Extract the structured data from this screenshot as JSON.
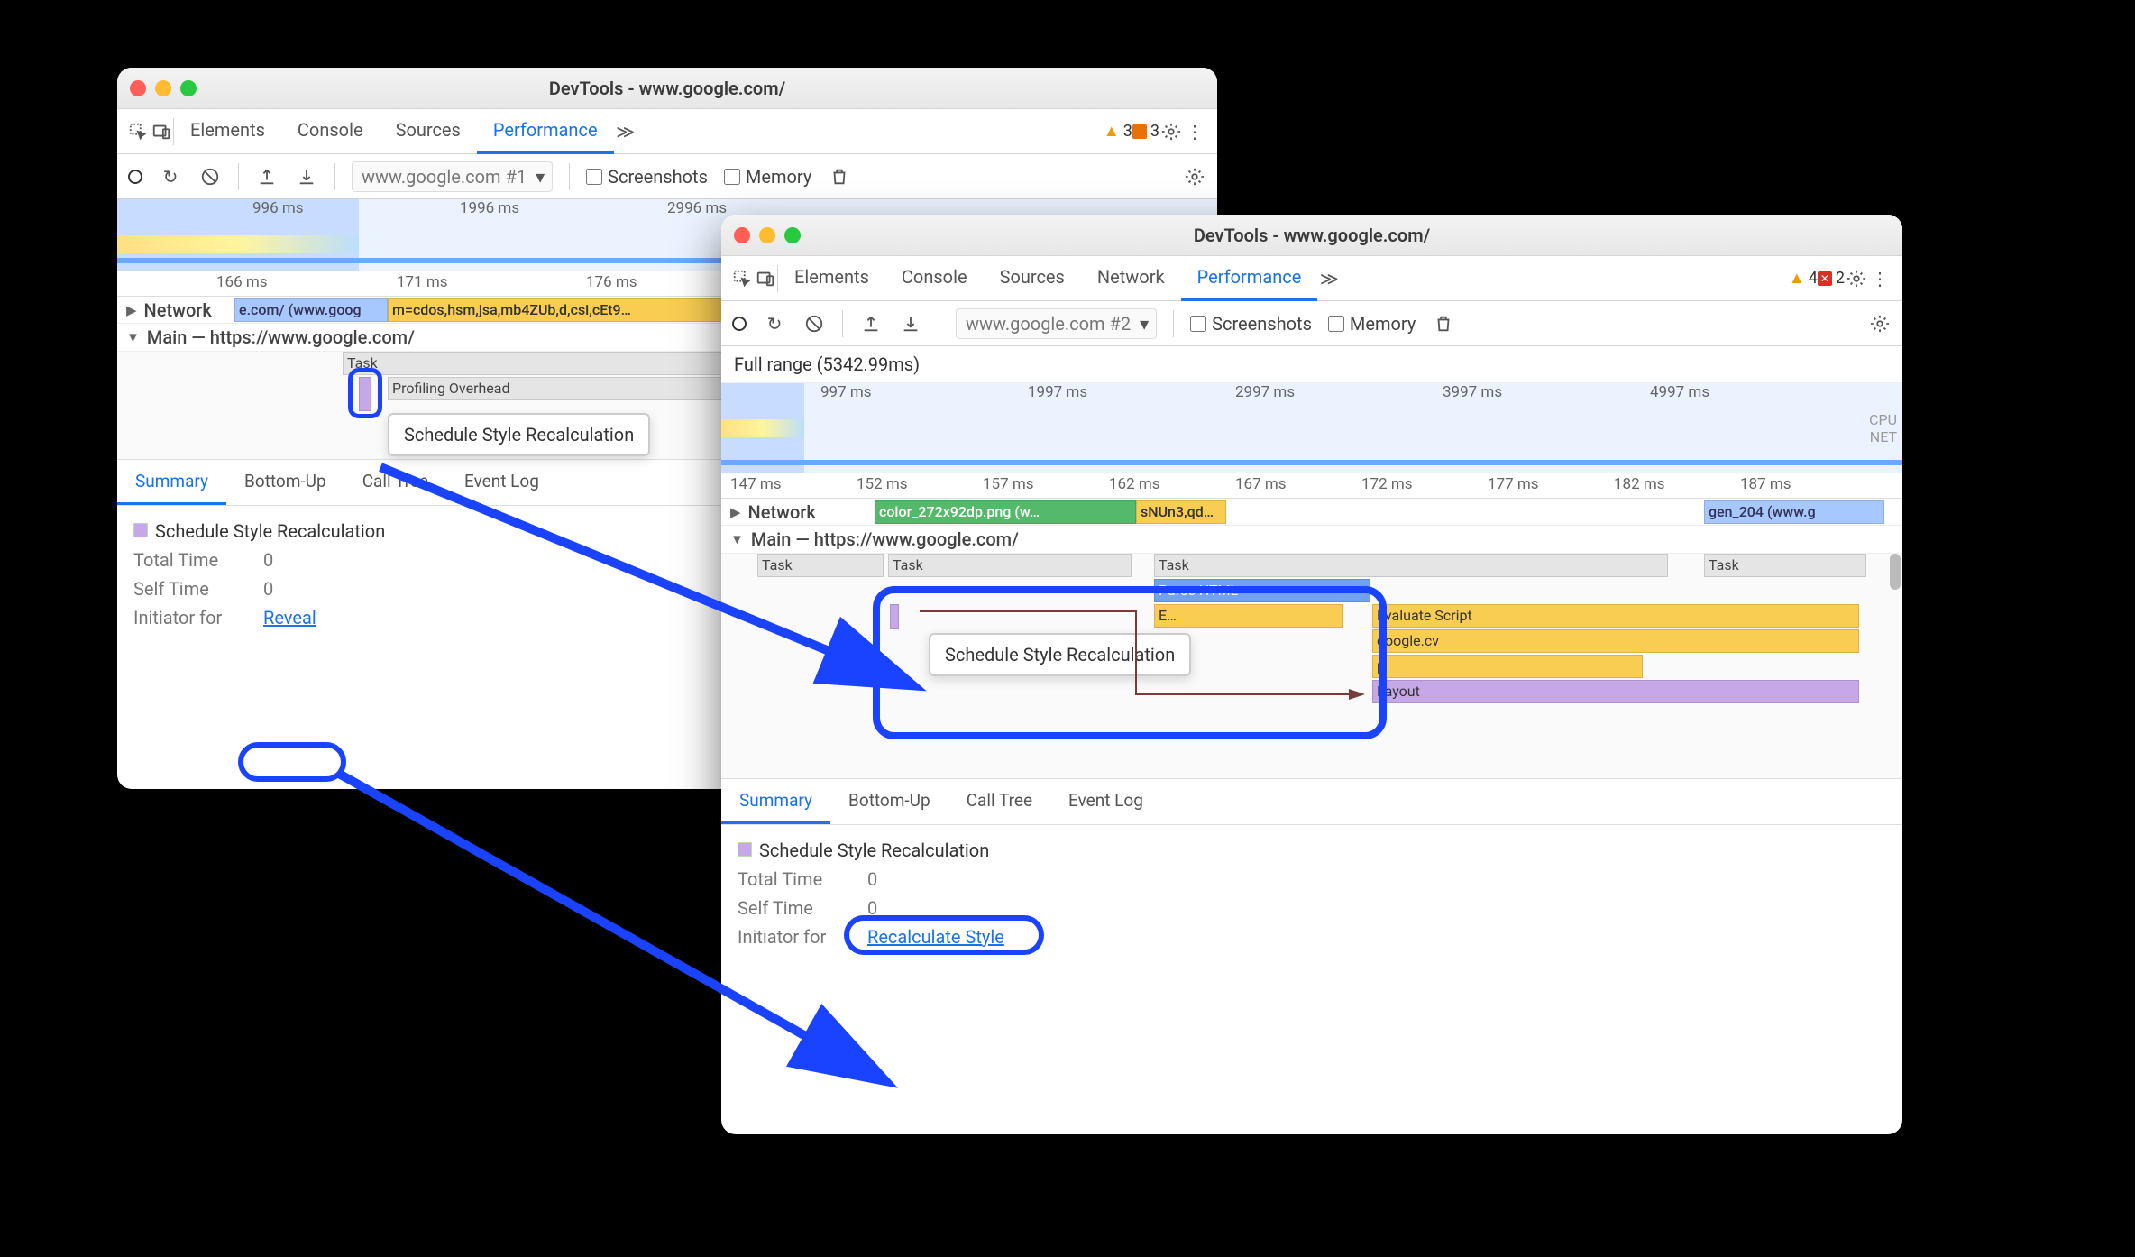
{
  "windowA": {
    "title": "DevTools - www.google.com/",
    "navTabs": [
      "Elements",
      "Console",
      "Sources",
      "Performance"
    ],
    "activeNavTab": "Performance",
    "warnCount": "3",
    "issueCount": "3",
    "urlLabel": "www.google.com #1",
    "cbScreenshots": "Screenshots",
    "cbMemory": "Memory",
    "timelineTicks": [
      "996 ms",
      "1996 ms",
      "2996 ms"
    ],
    "rulerTicks": [
      "166 ms",
      "171 ms",
      "176 ms"
    ],
    "networkLabel": "Network",
    "networkEntryA": "e.com/ (www.goog",
    "networkEntryB": "m=cdos,hsm,jsa,mb4ZUb,d,csi,cEt9…",
    "mainLabel": "Main — https://www.google.com/",
    "flameTask": "Task",
    "flameOverhead": "Profiling Overhead",
    "tooltip": "Schedule Style Recalculation",
    "summaryTabs": [
      "Summary",
      "Bottom-Up",
      "Call Tree",
      "Event Log"
    ],
    "activeSummaryTab": "Summary",
    "summaryTitle": "Schedule Style Recalculation",
    "totalTimeLabel": "Total Time",
    "totalTimeVal": "0",
    "selfTimeLabel": "Self Time",
    "selfTimeVal": "0",
    "initiatorLabel": "Initiator for",
    "revealLink": "Reveal"
  },
  "windowB": {
    "title": "DevTools - www.google.com/",
    "navTabs": [
      "Elements",
      "Console",
      "Sources",
      "Network",
      "Performance"
    ],
    "activeNavTab": "Performance",
    "warnCount": "4",
    "errCount": "2",
    "urlLabel": "www.google.com #2",
    "cbScreenshots": "Screenshots",
    "cbMemory": "Memory",
    "fullRange": "Full range (5342.99ms)",
    "timelineTicks": [
      "997 ms",
      "1997 ms",
      "2997 ms",
      "3997 ms",
      "4997 ms"
    ],
    "rulerTicks": [
      "147 ms",
      "152 ms",
      "157 ms",
      "162 ms",
      "167 ms",
      "172 ms",
      "177 ms",
      "182 ms",
      "187 ms"
    ],
    "networkLabel": "Network",
    "netEntry1": "color_272x92dp.png (w…",
    "netEntry2": "sNUn3,qd…",
    "netEntry3": "gen_204 (www.g",
    "mainLabel": "Main — https://www.google.com/",
    "tasks": "Task",
    "parseHtml": "Parse HTML",
    "evaluateScript": "Evaluate Script",
    "googlecv": "google.cv",
    "pLabel": "p",
    "layout": "Layout",
    "evShort": "E…",
    "tooltip": "Schedule Style Recalculation",
    "summaryTabs": [
      "Summary",
      "Bottom-Up",
      "Call Tree",
      "Event Log"
    ],
    "activeSummaryTab": "Summary",
    "summaryTitle": "Schedule Style Recalculation",
    "totalTimeLabel": "Total Time",
    "totalTimeVal": "0",
    "selfTimeLabel": "Self Time",
    "selfTimeVal": "0",
    "initiatorLabel": "Initiator for",
    "recalcLink": "Recalculate Style",
    "cpuLabel": "CPU",
    "netLabel": "NET"
  }
}
